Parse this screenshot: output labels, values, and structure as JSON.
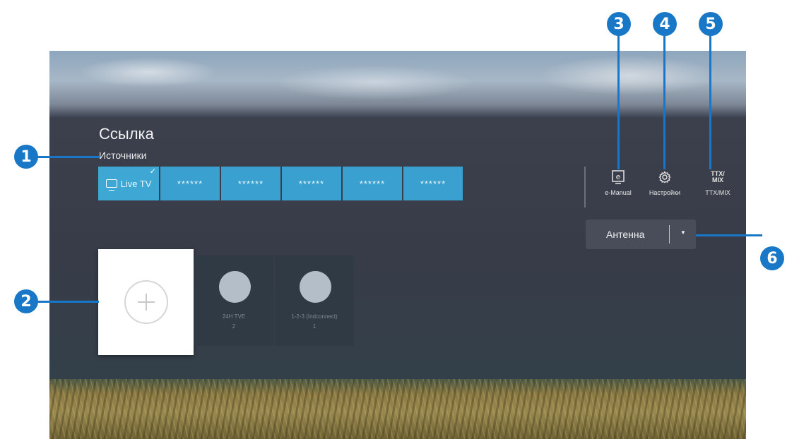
{
  "header": {
    "title": "Ссылка",
    "sources_label": "Источники"
  },
  "sources": [
    {
      "label": "Live TV",
      "selected": true
    },
    {
      "label": "******"
    },
    {
      "label": "******"
    },
    {
      "label": "******"
    },
    {
      "label": "******"
    },
    {
      "label": "******"
    }
  ],
  "actions": {
    "emanual": {
      "label": "e-Manual",
      "icon": "e-manual-icon"
    },
    "settings": {
      "label": "Настройки",
      "icon": "gear-icon"
    },
    "ttx": {
      "label": "TTX/MIX",
      "icon": "ttx-mix-icon",
      "glyph_top": "TTX/",
      "glyph_bottom": "MIX"
    }
  },
  "antenna": {
    "label": "Антенна"
  },
  "channels": [
    {
      "line1": "24H TVE",
      "line2": "2"
    },
    {
      "line1": "1-2-3 (Indconnect)",
      "line2": "1"
    }
  ],
  "callouts": [
    "1",
    "2",
    "3",
    "4",
    "5",
    "6"
  ],
  "colors": {
    "accent": "#1877c6",
    "source_tile": "#3aa0cf"
  }
}
